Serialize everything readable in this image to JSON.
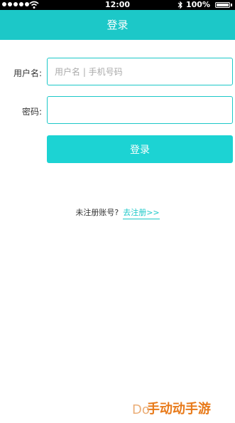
{
  "status_bar": {
    "time": "12:00",
    "battery": "100%"
  },
  "header": {
    "title": "登录"
  },
  "form": {
    "username_label": "用户名:",
    "username_placeholder": "用户名 | 手机号码",
    "password_label": "密码:",
    "login_label": "登录"
  },
  "register": {
    "prompt": "未注册账号?",
    "link_label": "去注册>>"
  },
  "watermark": {
    "prefix": "Do",
    "text": "手动动手游"
  },
  "colors": {
    "accent": "#1cc8c8",
    "button": "#1cd3d3",
    "watermark": "#e87a1a"
  }
}
